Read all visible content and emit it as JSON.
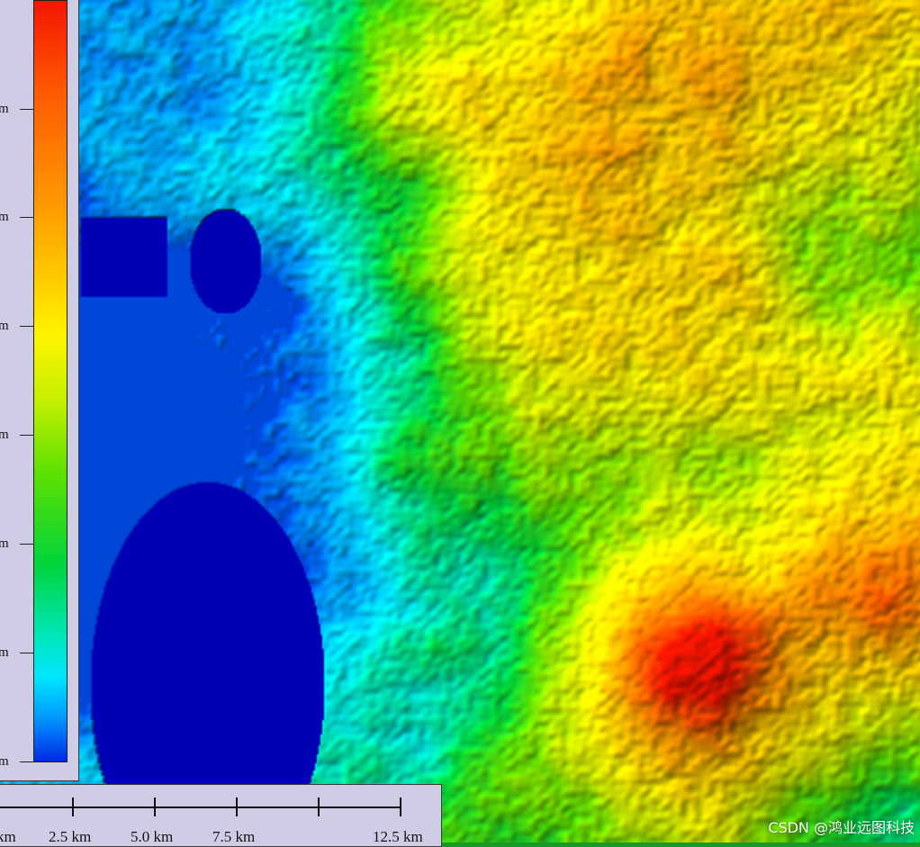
{
  "map": {
    "colormap": [
      "#0028e6",
      "#009cff",
      "#00e6ff",
      "#00e6b4",
      "#00d43a",
      "#5ee000",
      "#c8f000",
      "#fff400",
      "#ffc800",
      "#ff9600",
      "#ff5a00",
      "#f41500"
    ],
    "water_color": "#0000b4"
  },
  "legend": {
    "labels": [
      "m",
      "m",
      "m",
      "m",
      "m",
      "m",
      "m",
      "m"
    ]
  },
  "scalebar": {
    "labels": [
      "km",
      "2.5 km",
      "5.0 km",
      "7.5 km",
      "12.5 km"
    ]
  },
  "watermark": "CSDN @鸿业远图科技"
}
